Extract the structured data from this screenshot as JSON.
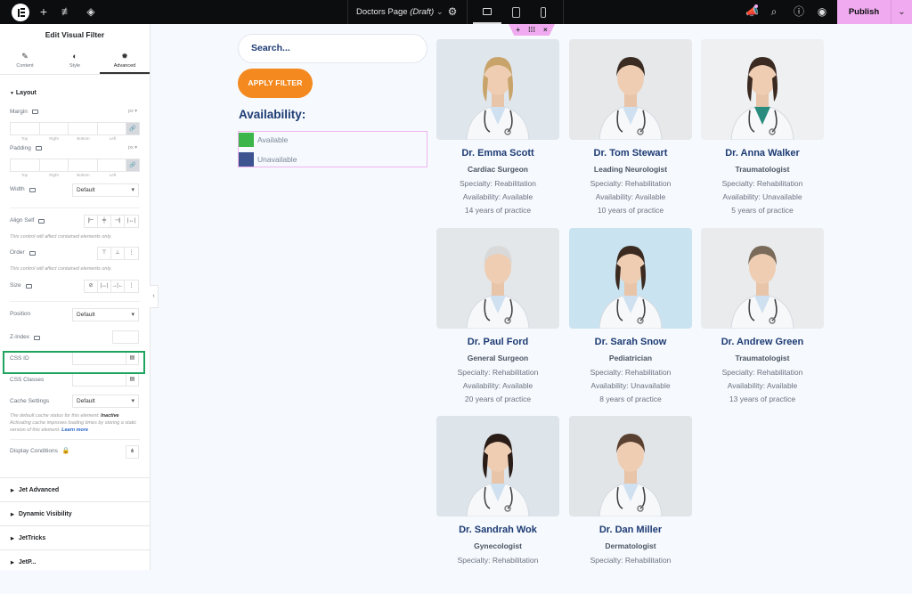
{
  "topbar": {
    "page_name": "Doctors Page",
    "page_status": "(Draft)",
    "publish_label": "Publish",
    "icons": [
      "elementor-logo-icon",
      "add-icon",
      "settings-sliders-icon",
      "layers-icon",
      "page-settings-icon",
      "desktop-icon",
      "tablet-icon",
      "mobile-icon",
      "notifications-icon",
      "search-icon",
      "help-icon",
      "preview-eye-icon",
      "chevron-down-icon"
    ]
  },
  "section_handle": {
    "add": "+",
    "drag": "⠿",
    "close": "×"
  },
  "panel": {
    "title": "Edit Visual Filter",
    "tabs": [
      {
        "label": "Content",
        "icon": "pencil-icon"
      },
      {
        "label": "Style",
        "icon": "contrast-icon"
      },
      {
        "label": "Advanced",
        "icon": "gear-icon",
        "active": true
      }
    ],
    "layout_section": "Layout",
    "margin_label": "Margin",
    "padding_label": "Padding",
    "unit": "px",
    "dim_labels": [
      "Top",
      "Right",
      "Bottom",
      "Left"
    ],
    "width_label": "Width",
    "width_value": "Default",
    "align_self_label": "Align Self",
    "contained_note": "This control will affect contained elements only.",
    "order_label": "Order",
    "size_label": "Size",
    "position_label": "Position",
    "position_value": "Default",
    "zindex_label": "Z-Index",
    "css_id_label": "CSS ID",
    "css_id_value": "",
    "css_classes_label": "CSS Classes",
    "css_classes_value": "",
    "cache_label": "Cache Settings",
    "cache_value": "Default",
    "cache_note_1": "The default cache status for this element:",
    "cache_note_status": "Inactive",
    "cache_note_2": "Activating cache improves loading times by storing a static version of this element.",
    "learn_more": "Learn more",
    "display_conditions_label": "Display Conditions",
    "collapsed_sections": [
      "Jet Advanced",
      "Dynamic Visibility",
      "JetTricks",
      "JetP..."
    ]
  },
  "filter": {
    "search_placeholder": "Search...",
    "apply_label": "APPLY FILTER",
    "availability_title": "Availability:",
    "options": [
      {
        "label": "Available",
        "color": "#3cb54a"
      },
      {
        "label": "Unavailable",
        "color": "#3d5491"
      }
    ]
  },
  "doctors": [
    {
      "name": "Dr. Emma Scott",
      "role": "Cardiac Surgeon",
      "specialty": "Specialty: Reabilitation",
      "availability": "Availability: Available",
      "experience": "14 years of practice",
      "gender": "f"
    },
    {
      "name": "Dr. Tom Stewart",
      "role": "Leading Neurologist",
      "specialty": "Specialty: Rehabilitation",
      "availability": "Availability: Available",
      "experience": "10 years of practice",
      "gender": "m"
    },
    {
      "name": "Dr. Anna Walker",
      "role": "Traumatologist",
      "specialty": "Specialty: Rehabilitation",
      "availability": "Availability: Unavailable",
      "experience": "5 years of practice",
      "gender": "f"
    },
    {
      "name": "Dr. Paul Ford",
      "role": "General Surgeon",
      "specialty": "Specialty: Rehabilitation",
      "availability": "Availability: Available",
      "experience": "20 years of practice",
      "gender": "m"
    },
    {
      "name": "Dr. Sarah Snow",
      "role": "Pediatrician",
      "specialty": "Specialty: Rehabilitation",
      "availability": "Availability: Unavailable",
      "experience": "8 years of practice",
      "gender": "f"
    },
    {
      "name": "Dr. Andrew Green",
      "role": "Traumatologist",
      "specialty": "Specialty: Rehabilitation",
      "availability": "Availability: Available",
      "experience": "13 years of practice",
      "gender": "m"
    },
    {
      "name": "Dr. Sandrah Wok",
      "role": "Gynecologist",
      "specialty": "Specialty: Rehabilitation",
      "availability": "",
      "experience": "",
      "gender": "f"
    },
    {
      "name": "Dr. Dan Miller",
      "role": "Dermatologist",
      "specialty": "Specialty: Rehabilitation",
      "availability": "",
      "experience": "",
      "gender": "m"
    }
  ]
}
